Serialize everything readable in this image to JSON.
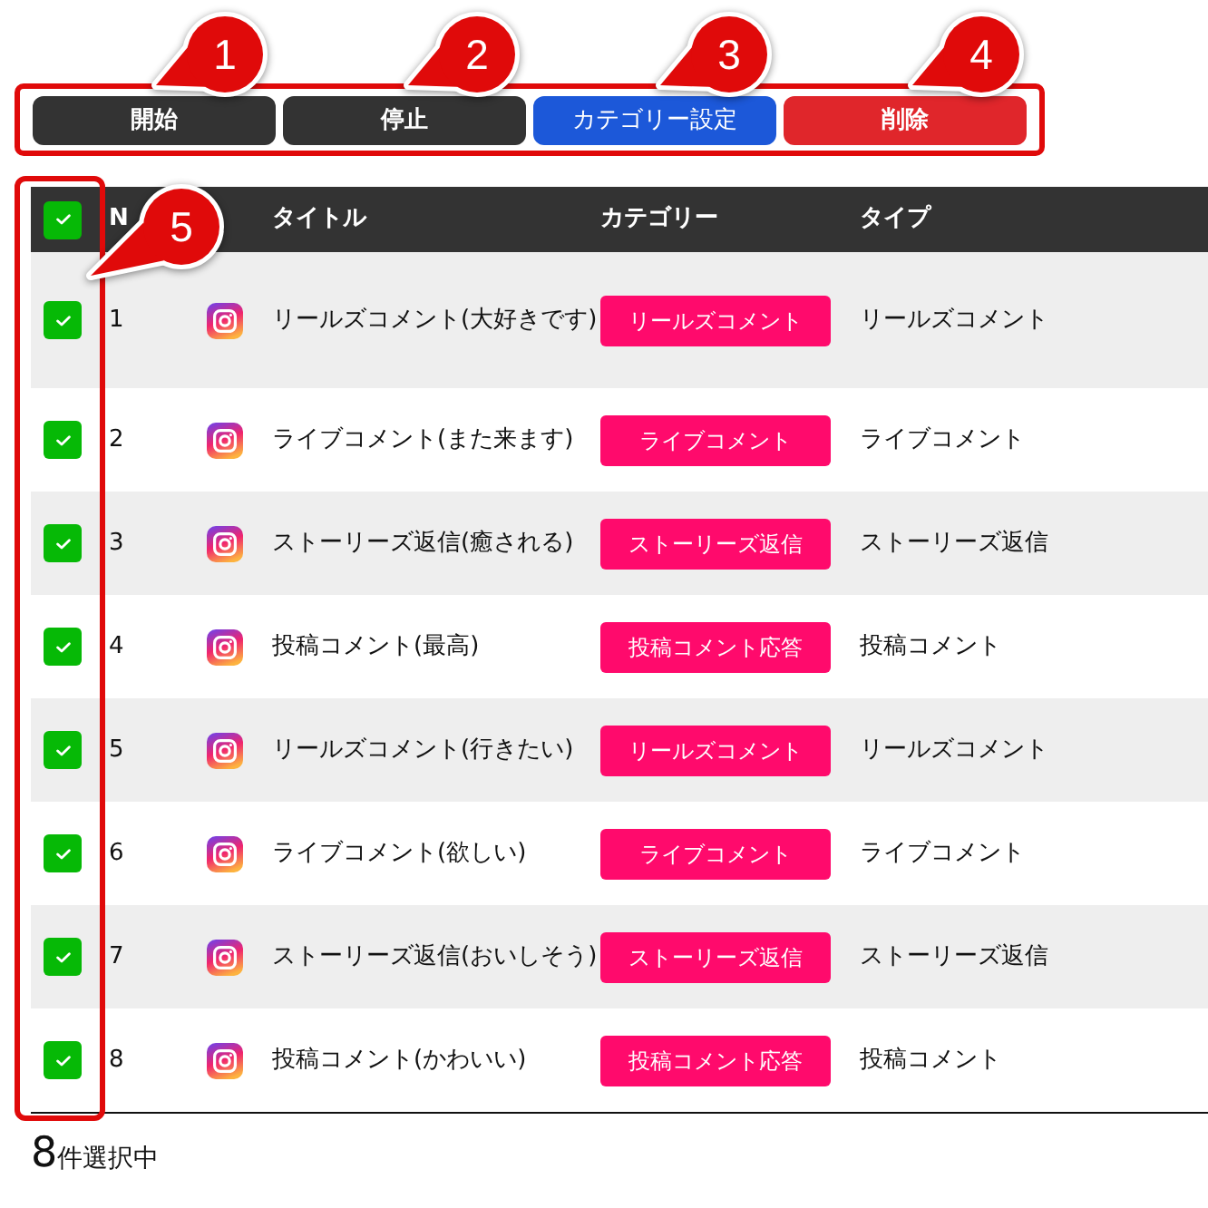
{
  "toolbar": {
    "highlighted": true,
    "buttons": [
      {
        "label": "開始",
        "kind": "dark"
      },
      {
        "label": "停止",
        "kind": "dark"
      },
      {
        "label": "カテゴリー設定",
        "kind": "primary"
      },
      {
        "label": "削除",
        "kind": "danger"
      }
    ]
  },
  "table": {
    "checkbox_column_highlighted": true,
    "select_all": {
      "checked": true
    },
    "columns": [
      "N",
      "タイトル",
      "カテゴリー",
      "タイプ"
    ],
    "rows": [
      {
        "checked": true,
        "number": "1",
        "title": "リールズコメント(大好きです)",
        "category": "リールズコメント",
        "type": "リールズコメント"
      },
      {
        "checked": true,
        "number": "2",
        "title": "ライブコメント(また来ます)",
        "category": "ライブコメント",
        "type": "ライブコメント"
      },
      {
        "checked": true,
        "number": "3",
        "title": "ストーリーズ返信(癒される)",
        "category": "ストーリーズ返信",
        "type": "ストーリーズ返信"
      },
      {
        "checked": true,
        "number": "4",
        "title": "投稿コメント(最高)",
        "category": "投稿コメント応答",
        "type": "投稿コメント"
      },
      {
        "checked": true,
        "number": "5",
        "title": "リールズコメント(行きたい)",
        "category": "リールズコメント",
        "type": "リールズコメント"
      },
      {
        "checked": true,
        "number": "6",
        "title": "ライブコメント(欲しい)",
        "category": "ライブコメント",
        "type": "ライブコメント"
      },
      {
        "checked": true,
        "number": "7",
        "title": "ストーリーズ返信(おいしそう)",
        "category": "ストーリーズ返信",
        "type": "ストーリーズ返信"
      },
      {
        "checked": true,
        "number": "8",
        "title": "投稿コメント(かわいい)",
        "category": "投稿コメント応答",
        "type": "投稿コメント"
      }
    ]
  },
  "selection_summary": {
    "count": "8",
    "label": "件選択中"
  },
  "callouts": [
    {
      "number": "1"
    },
    {
      "number": "2"
    },
    {
      "number": "3"
    },
    {
      "number": "4"
    },
    {
      "number": "5"
    }
  ]
}
